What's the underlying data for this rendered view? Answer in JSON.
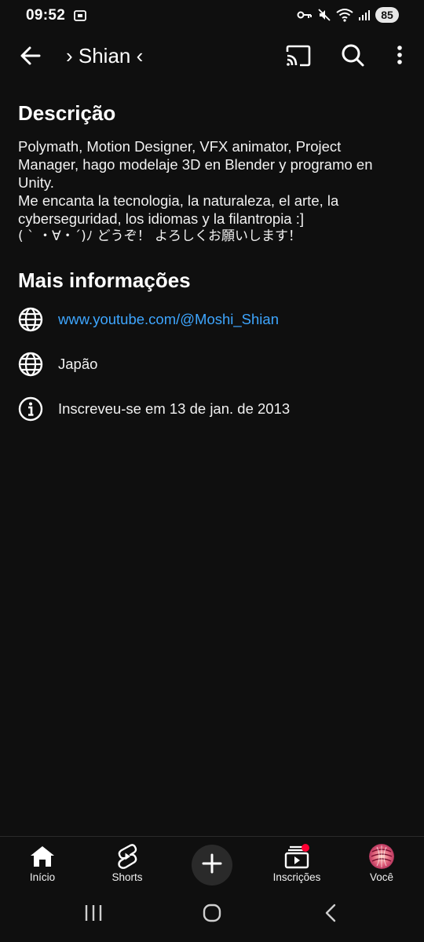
{
  "status_bar": {
    "time": "09:52",
    "battery": "85",
    "icons": [
      "screenshot-icon",
      "vpn-key-icon",
      "mute-icon",
      "wifi-icon",
      "signal-icon"
    ]
  },
  "header": {
    "title": "› Shian ‹",
    "icons": [
      "back-arrow-icon",
      "cast-icon",
      "search-icon",
      "more-vert-icon"
    ]
  },
  "description": {
    "heading": "Descrição",
    "lines": [
      "Polymath, Motion Designer, VFX animator, Project",
      "Manager, hago modelaje 3D en Blender y programo en",
      "Unity.",
      "Me encanta la tecnologia, la naturaleza, el arte, la",
      "cyberseguridad, los idiomas y la filantropia :]",
      "( ˋ ・∀・ˊ)ﾉ どうぞ！ よろしくお願いします！"
    ]
  },
  "more_info": {
    "heading": "Mais informações",
    "link": "www.youtube.com/@Moshi_Shian",
    "country": "Japão",
    "joined": "Inscreveu-se em 13 de jan. de 2013"
  },
  "bottom_nav": {
    "home": "Início",
    "shorts": "Shorts",
    "subscriptions": "Inscrições",
    "you": "Você"
  },
  "colors": {
    "background": "#0f0f0f",
    "text": "#f1f1f1",
    "link": "#3ea6ff",
    "notification_dot": "#ff0033"
  }
}
